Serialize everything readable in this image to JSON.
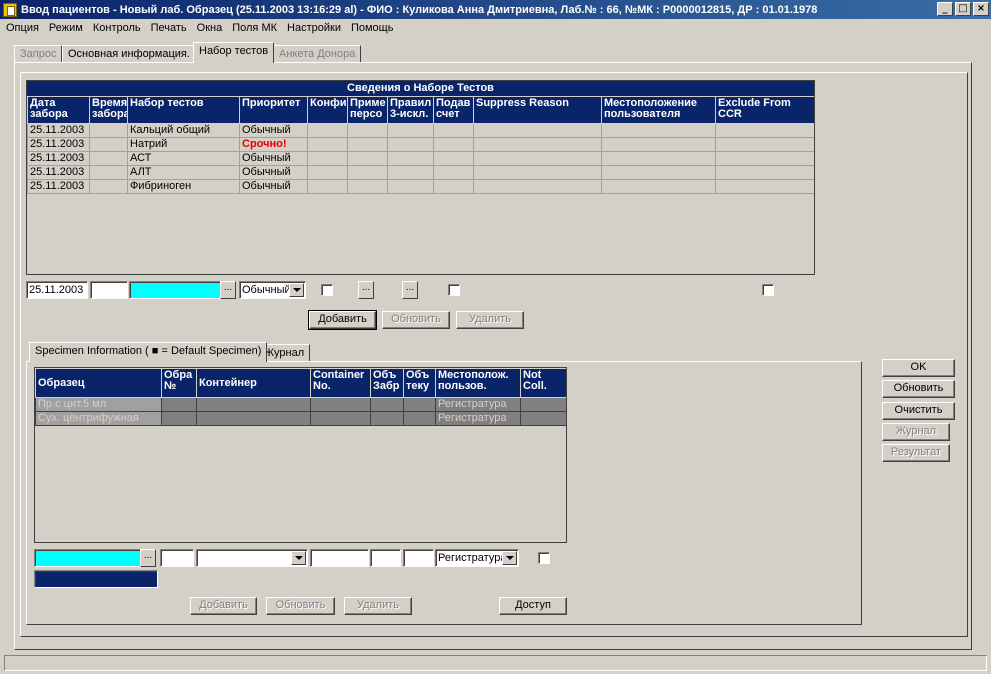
{
  "window": {
    "title": "Ввод пациентов - Новый лаб. Образец (25.11.2003 13:16:29 al)  - ФИО : Куликова Анна Дмитриевна, Лаб.№ : 66, №МК : P0000012815, ДР : 01.01.1978",
    "minimize": "_",
    "maximize": "□",
    "close": "×"
  },
  "menu": [
    "Опция",
    "Режим",
    "Контроль",
    "Печать",
    "Окна",
    "Поля МК",
    "Настройки",
    "Помощь"
  ],
  "tabs": [
    {
      "label": "Запрос",
      "state": "disabled"
    },
    {
      "label": "Основная информация.",
      "state": "normal"
    },
    {
      "label": "Набор тестов",
      "state": "active"
    },
    {
      "label": "Анкета Донора",
      "state": "disabled"
    }
  ],
  "tests_grid": {
    "caption": "Сведения о Наборе Тестов",
    "columns": [
      "Дата забора",
      "Время забора",
      "Набор тестов",
      "Приоритет",
      "Конфи",
      "Приме персо",
      "Правил 3-искл.",
      "Подав счет",
      "Suppress Reason",
      "Местоположение пользователя",
      "Exclude From CCR"
    ],
    "rows": [
      {
        "date": "25.11.2003",
        "time": "",
        "test": "Кальций общий",
        "priority": "Обычный",
        "urgent": false
      },
      {
        "date": "25.11.2003",
        "time": "",
        "test": "Натрий",
        "priority": "Срочно!",
        "urgent": true
      },
      {
        "date": "25.11.2003",
        "time": "",
        "test": "АСТ",
        "priority": "Обычный",
        "urgent": false
      },
      {
        "date": "25.11.2003",
        "time": "",
        "test": "АЛТ",
        "priority": "Обычный",
        "urgent": false
      },
      {
        "date": "25.11.2003",
        "time": "",
        "test": "Фибриноген",
        "priority": "Обычный",
        "urgent": false
      }
    ]
  },
  "test_edit": {
    "date": "25.11.2003",
    "priority": "Обычный",
    "ellipsis": "..."
  },
  "test_buttons": {
    "add": "Добавить",
    "update": "Обновить",
    "delete": "Удалить"
  },
  "sub_tabs": [
    {
      "label": "Specimen Information ( ■ = Default Specimen)",
      "state": "active"
    },
    {
      "label": "Журнал",
      "state": "normal"
    }
  ],
  "specimen_grid": {
    "columns": [
      "Образец",
      "Обра №",
      "Контейнер",
      "Container No.",
      "Объ Забр",
      "Объ теку",
      "Местополож. пользов.",
      "Not Coll."
    ],
    "rows": [
      {
        "specimen": "Пр.с цит.5 мл",
        "location": "Регистратура"
      },
      {
        "specimen": "Сух. центрифужная",
        "location": "Регистратура"
      }
    ]
  },
  "specimen_edit": {
    "location": "Регистратура",
    "ellipsis": "..."
  },
  "specimen_buttons": {
    "add": "Добавить",
    "update": "Обновить",
    "delete": "Удалить",
    "access": "Доступ"
  },
  "side_buttons": {
    "ok": "OK",
    "update": "Обновить",
    "clear": "Очистить",
    "journal": "Журнал",
    "result": "Результат"
  }
}
